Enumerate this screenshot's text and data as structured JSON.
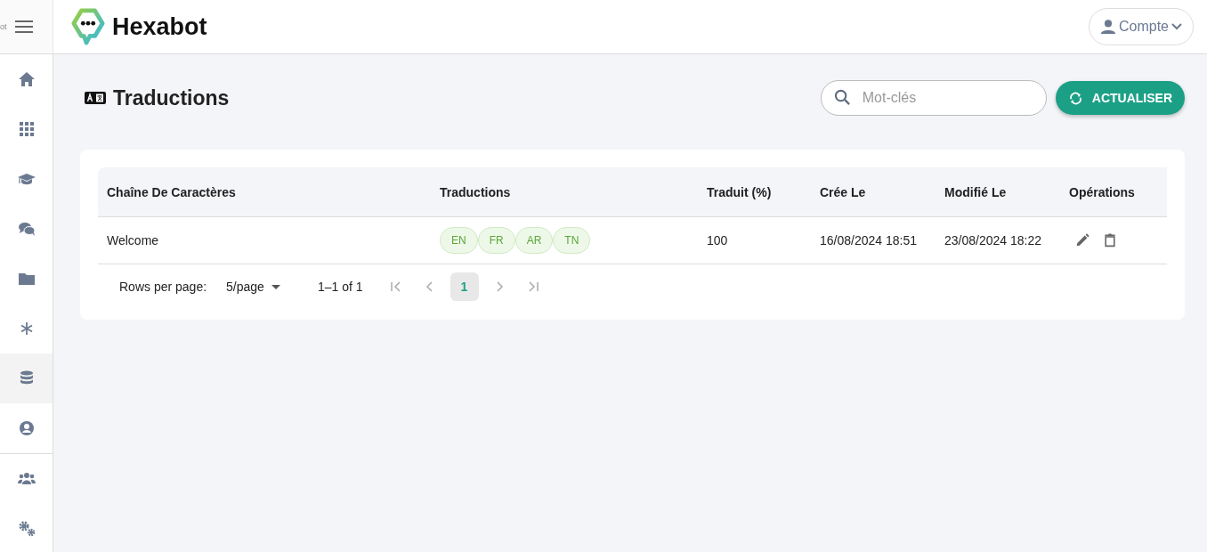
{
  "header": {
    "cut_text": "ot",
    "brand": "Hexabot",
    "account": "Compte"
  },
  "sidebar": {
    "groups": [
      [
        {
          "selected": false
        },
        {
          "selected": false
        },
        {
          "selected": false
        },
        {
          "selected": false
        },
        {
          "selected": false
        },
        {
          "selected": false
        },
        {
          "selected": true
        },
        {
          "selected": false
        }
      ],
      [
        {
          "selected": false
        },
        {
          "selected": false
        }
      ]
    ]
  },
  "page": {
    "title": "Traductions",
    "search": {
      "placeholder": "Mot-clés"
    },
    "refresh_button": "ACTUALISER"
  },
  "table": {
    "columns": [
      "Chaîne De Caractères",
      "Traductions",
      "Traduit (%)",
      "Crée Le",
      "Modifié Le",
      "Opérations"
    ],
    "rows": [
      {
        "string": "Welcome",
        "translations": [
          "EN",
          "FR",
          "AR",
          "TN"
        ],
        "translated": "100",
        "created": "16/08/2024 18:51",
        "modified": "23/08/2024 18:22"
      }
    ]
  },
  "pagination": {
    "rows_label": "Rows per page:",
    "rows_value": "5/page",
    "range": "1–1 of 1",
    "pages": [
      {
        "label": "1",
        "selected": true
      }
    ]
  }
}
